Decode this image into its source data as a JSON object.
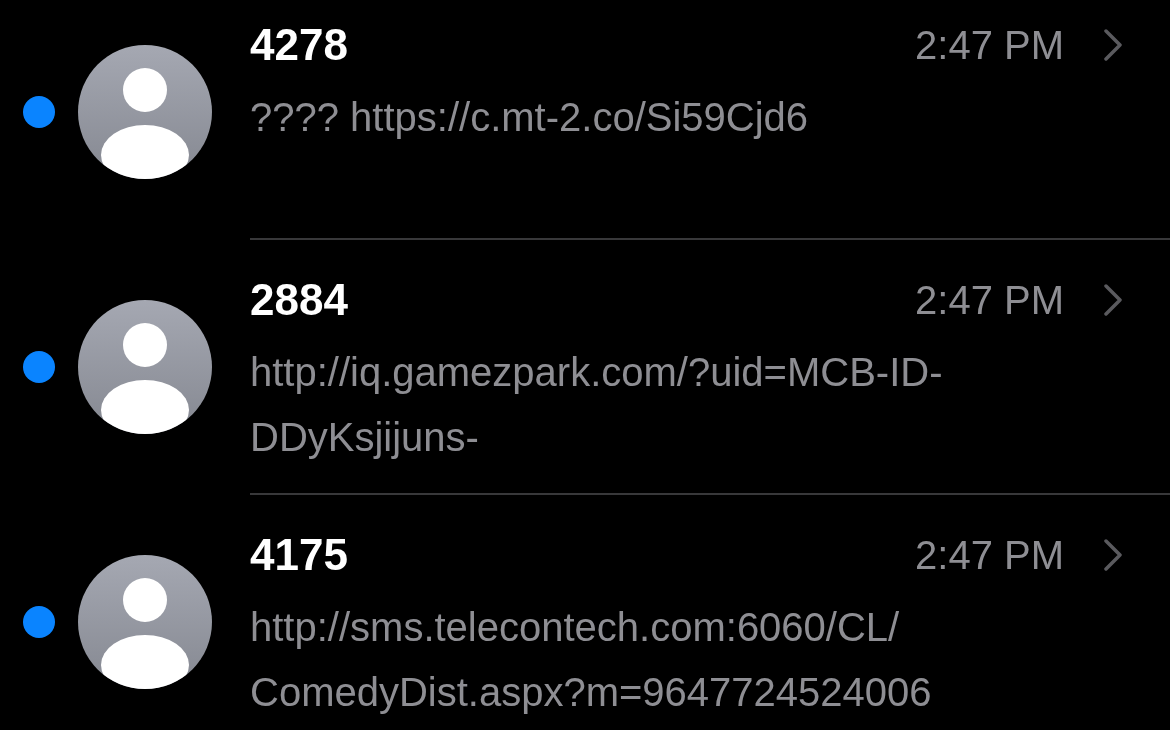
{
  "conversations": [
    {
      "sender": "4278",
      "time": "2:47 PM",
      "unread": true,
      "preview": [
        "???? https://c.mt-2.co/Si59Cjd6"
      ]
    },
    {
      "sender": "2884",
      "time": "2:47 PM",
      "unread": true,
      "preview": [
        "http://iq.gamezpark.com/?uid=MCB-ID-",
        "DDyKsjijuns-"
      ]
    },
    {
      "sender": "4175",
      "time": "2:47 PM",
      "unread": true,
      "preview": [
        "http://sms.telecontech.com:6060/CL/",
        "ComedyDist.aspx?m=9647724524006"
      ]
    }
  ]
}
